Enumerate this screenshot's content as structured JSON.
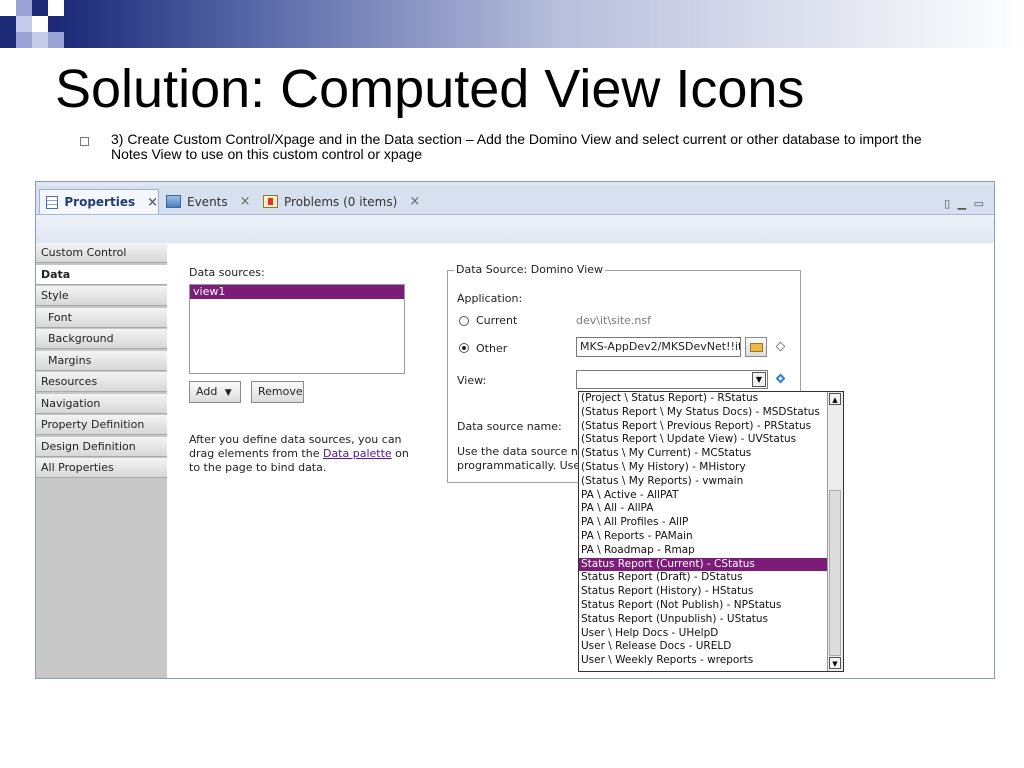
{
  "slide": {
    "title": "Solution: Computed View Icons",
    "bullet": "3) Create Custom Control/Xpage and in the Data section – Add the Domino View and select current or other database to import the Notes View to use on this custom control or xpage"
  },
  "tabs": [
    {
      "label": "Properties",
      "icon": "properties-icon"
    },
    {
      "label": "Events",
      "icon": "events-icon"
    },
    {
      "label": "Problems (0 items)",
      "icon": "problems-icon"
    }
  ],
  "tab_close": "×",
  "nav": {
    "items": [
      {
        "label": "Custom Control"
      },
      {
        "label": "Data"
      },
      {
        "label": "Style"
      },
      {
        "label": "Font"
      },
      {
        "label": "Background"
      },
      {
        "label": "Margins"
      },
      {
        "label": "Resources"
      },
      {
        "label": "Navigation"
      },
      {
        "label": "Property Definition"
      },
      {
        "label": "Design Definition"
      },
      {
        "label": "All Properties"
      }
    ]
  },
  "data_sources": {
    "label": "Data sources:",
    "items": [
      "view1"
    ],
    "add_label": "Add",
    "remove_label": "Remove",
    "help_before": "After you define data sources, you can drag elements from the ",
    "help_link": "Data palette",
    "help_after": " on to the page to bind data."
  },
  "domino_view": {
    "group_title": "Data Source: Domino View",
    "application_label": "Application:",
    "current_label": "Current",
    "current_path": "dev\\it\\site.nsf",
    "other_label": "Other",
    "other_value": "MKS-AppDev2/MKSDevNet!!it\\",
    "view_label": "View:",
    "data_source_name_label": "Data source name:",
    "use_text_1": "Use the data source na",
    "use_text_2": "programmatically. Use c"
  },
  "view_options": [
    "(Project \\ Status Report)  -  RStatus",
    "(Status Report \\ My Status Docs)  -  MSDStatus",
    "(Status Report \\ Previous Report)  -  PRStatus",
    "(Status Report \\ Update View)  -  UVStatus",
    "(Status \\ My Current)  -  MCStatus",
    "(Status \\ My History)  -  MHistory",
    "(Status \\ My Reports)  -  vwmain",
    "PA \\ Active  -  AllPAT",
    "PA \\ All  -  AllPA",
    "PA \\ All Profiles  -  AllP",
    "PA \\ Reports  -  PAMain",
    "PA \\ Roadmap  -  Rmap",
    "Status Report (Current)  -  CStatus",
    "Status Report (Draft)  -  DStatus",
    "Status Report (History)  -  HStatus",
    "Status Report (Not Publish)  -  NPStatus",
    "Status Report (Unpublish)  -  UStatus",
    "User \\ Help Docs  -  UHelpD",
    "User \\ Release Docs  -  URELD",
    "User \\ Weekly Reports  -  wreports"
  ],
  "selected_view_index": 12,
  "colors": {
    "selection": "#7b1c78",
    "slide_navy": "#1c2a78",
    "link": "#4b1a9e"
  }
}
